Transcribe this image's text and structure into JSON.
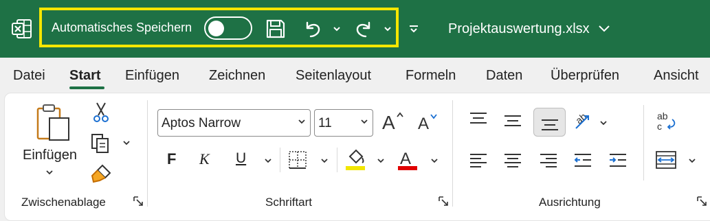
{
  "titlebar": {
    "autosave_label": "Automatisches Speichern",
    "filename": "Projektauswertung.xlsx",
    "bg_color": "#1e7145",
    "highlight_color": "#f5e600"
  },
  "tabs": [
    {
      "label": "Datei"
    },
    {
      "label": "Start"
    },
    {
      "label": "Einfügen"
    },
    {
      "label": "Zeichnen"
    },
    {
      "label": "Seitenlayout"
    },
    {
      "label": "Formeln"
    },
    {
      "label": "Daten"
    },
    {
      "label": "Überprüfen"
    },
    {
      "label": "Ansicht"
    }
  ],
  "active_tab": "Start",
  "clipboard": {
    "paste_label": "Einfügen",
    "group_label": "Zwischenablage"
  },
  "font": {
    "family_value": "Aptos Narrow",
    "size_value": "11",
    "bold_label": "F",
    "italic_label": "K",
    "underline_label": "U",
    "fill_color": "#f2e600",
    "font_color": "#e00000",
    "group_label": "Schriftart"
  },
  "alignment": {
    "group_label": "Ausrichtung"
  }
}
